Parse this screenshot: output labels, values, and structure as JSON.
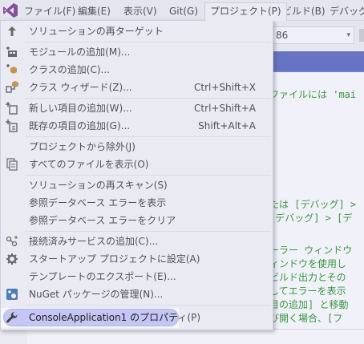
{
  "menubar": {
    "items": [
      "ファイル(F)",
      "編集(E)",
      "表示(V)",
      "Git(G)",
      "プロジェクト(P)",
      "ビルド(B)",
      "デバッグ("
    ],
    "open_item": "プロジェクト(P)"
  },
  "toolbar": {
    "platform_value": "86",
    "dropdown_arrow": "▾"
  },
  "editor": {
    "lines": [
      "ファイルには 'mai",
      "たは [デバッグ] >",
      "[デバッグ] > [デ",
      "ーラー ウィンドウ",
      "ィンドウを使用し",
      "ビルド出力とその",
      "してエラーを表示",
      "目の追加] と移動",
      "び開く場合、[フ"
    ]
  },
  "project_menu": {
    "items": [
      {
        "icon": "up-arrow-icon",
        "label": "ソリューションの再ターゲット",
        "shortcut": ""
      },
      {
        "icon": "add-module-icon",
        "label": "モジュールの追加(M)...",
        "shortcut": ""
      },
      {
        "icon": "add-class-icon",
        "label": "クラスの追加(C)...",
        "shortcut": ""
      },
      {
        "icon": "class-wizard-icon",
        "label": "クラス ウィザード(Z)...",
        "shortcut": "Ctrl+Shift+X"
      },
      {
        "icon": "new-item-icon",
        "label": "新しい項目の追加(W)...",
        "shortcut": "Ctrl+Shift+A"
      },
      {
        "icon": "existing-item-icon",
        "label": "既存の項目の追加(G)...",
        "shortcut": "Shift+Alt+A"
      },
      {
        "icon": "",
        "label": "プロジェクトから除外(J)",
        "shortcut": ""
      },
      {
        "icon": "show-all-files-icon",
        "label": "すべてのファイルを表示(O)",
        "shortcut": ""
      },
      {
        "icon": "",
        "label": "ソリューションの再スキャン(S)",
        "shortcut": ""
      },
      {
        "icon": "",
        "label": "参照データベース エラーを表示",
        "shortcut": ""
      },
      {
        "icon": "",
        "label": "参照データベース エラーをクリア",
        "shortcut": ""
      },
      {
        "icon": "connected-service-icon",
        "label": "接続済みサービスの追加(C)...",
        "shortcut": ""
      },
      {
        "icon": "gear-icon",
        "label": "スタートアップ プロジェクトに設定(A)",
        "shortcut": ""
      },
      {
        "icon": "",
        "label": "テンプレートのエクスポート(E)...",
        "shortcut": ""
      },
      {
        "icon": "nuget-icon",
        "label": "NuGet パッケージの管理(N)...",
        "shortcut": ""
      },
      {
        "icon": "wrench-icon",
        "label": "ConsoleApplication1 のプロパティ(P)",
        "shortcut": ""
      }
    ],
    "highlighted_label": "ConsoleApplication1 のプロパティ(P)"
  },
  "colors": {
    "accent": "#3f51b5",
    "vs_logo": "#68217a",
    "highlight": "#c4c6f5",
    "code_comment": "#008000"
  }
}
